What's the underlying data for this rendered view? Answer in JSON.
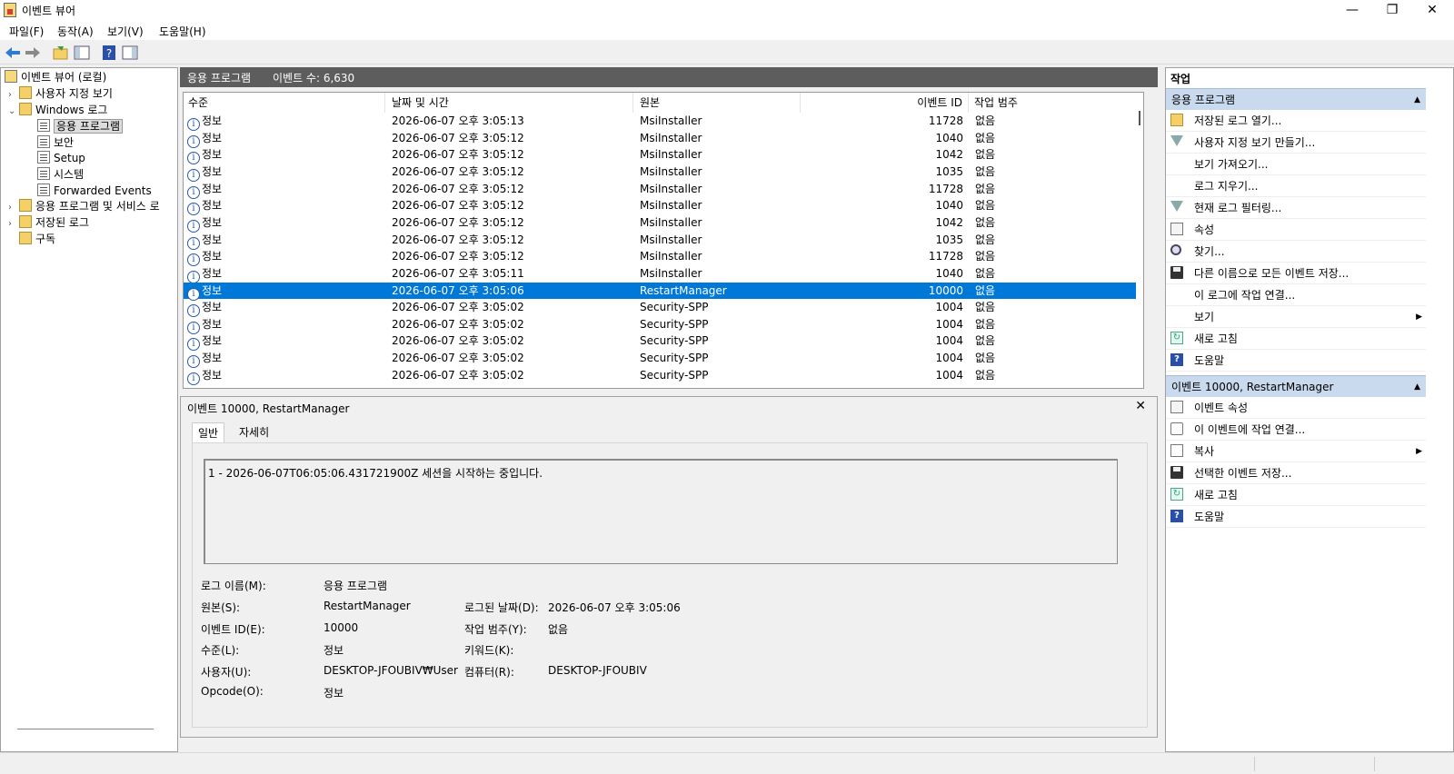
{
  "window": {
    "title": "이벤트 뷰어",
    "controls": {
      "minimize": "—",
      "maximize": "❐",
      "close": "✕"
    }
  },
  "menubar": {
    "items": [
      "파일(F)",
      "동작(A)",
      "보기(V)",
      "도움말(H)"
    ]
  },
  "tree": {
    "root": "이벤트 뷰어 (로컬)",
    "custom_views": "사용자 지정 보기",
    "windows_logs": "Windows 로그",
    "application": "응용 프로그램",
    "security": "보안",
    "setup": "Setup",
    "system": "시스템",
    "forwarded": "Forwarded Events",
    "apps_services": "응용 프로그램 및 서비스 로",
    "saved_logs": "저장된 로그",
    "subscriptions": "구독"
  },
  "list": {
    "header_title": "응용 프로그램",
    "event_count": "이벤트 수: 6,630",
    "columns": {
      "level": "수준",
      "date": "날짜 및 시간",
      "source": "원본",
      "event_id": "이벤트 ID",
      "category": "작업 범주"
    },
    "rows": [
      {
        "level": "정보",
        "date": "2026-06-07 오후 3:05:13",
        "source": "MsiInstaller",
        "event_id": "11728",
        "category": "없음"
      },
      {
        "level": "정보",
        "date": "2026-06-07 오후 3:05:12",
        "source": "MsiInstaller",
        "event_id": "1040",
        "category": "없음"
      },
      {
        "level": "정보",
        "date": "2026-06-07 오후 3:05:12",
        "source": "MsiInstaller",
        "event_id": "1042",
        "category": "없음"
      },
      {
        "level": "정보",
        "date": "2026-06-07 오후 3:05:12",
        "source": "MsiInstaller",
        "event_id": "1035",
        "category": "없음"
      },
      {
        "level": "정보",
        "date": "2026-06-07 오후 3:05:12",
        "source": "MsiInstaller",
        "event_id": "11728",
        "category": "없음"
      },
      {
        "level": "정보",
        "date": "2026-06-07 오후 3:05:12",
        "source": "MsiInstaller",
        "event_id": "1040",
        "category": "없음"
      },
      {
        "level": "정보",
        "date": "2026-06-07 오후 3:05:12",
        "source": "MsiInstaller",
        "event_id": "1042",
        "category": "없음"
      },
      {
        "level": "정보",
        "date": "2026-06-07 오후 3:05:12",
        "source": "MsiInstaller",
        "event_id": "1035",
        "category": "없음"
      },
      {
        "level": "정보",
        "date": "2026-06-07 오후 3:05:12",
        "source": "MsiInstaller",
        "event_id": "11728",
        "category": "없음"
      },
      {
        "level": "정보",
        "date": "2026-06-07 오후 3:05:11",
        "source": "MsiInstaller",
        "event_id": "1040",
        "category": "없음"
      },
      {
        "level": "정보",
        "date": "2026-06-07 오후 3:05:06",
        "source": "RestartManager",
        "event_id": "10000",
        "category": "없음"
      },
      {
        "level": "정보",
        "date": "2026-06-07 오후 3:05:02",
        "source": "Security-SPP",
        "event_id": "1004",
        "category": "없음"
      },
      {
        "level": "정보",
        "date": "2026-06-07 오후 3:05:02",
        "source": "Security-SPP",
        "event_id": "1004",
        "category": "없음"
      },
      {
        "level": "정보",
        "date": "2026-06-07 오후 3:05:02",
        "source": "Security-SPP",
        "event_id": "1004",
        "category": "없음"
      },
      {
        "level": "정보",
        "date": "2026-06-07 오후 3:05:02",
        "source": "Security-SPP",
        "event_id": "1004",
        "category": "없음"
      },
      {
        "level": "정보",
        "date": "2026-06-07 오후 3:05:02",
        "source": "Security-SPP",
        "event_id": "1004",
        "category": "없음"
      }
    ],
    "selected_index": 10
  },
  "detail": {
    "title": "이벤트 10000, RestartManager",
    "close": "✕",
    "tabs": {
      "general": "일반",
      "details": "자세히"
    },
    "message": "1 - 2026-06-07T06:05:06.431721900Z 세션을 시작하는 중입니다.",
    "labels": {
      "log_name": "로그 이름(M):",
      "source": "원본(S):",
      "event_id": "이벤트 ID(E):",
      "level": "수준(L):",
      "user": "사용자(U):",
      "opcode": "Opcode(O):",
      "logged": "로그된 날짜(D):",
      "category": "작업 범주(Y):",
      "keywords": "키워드(K):",
      "computer": "컴퓨터(R):"
    },
    "values": {
      "log_name": "응용 프로그램",
      "source": "RestartManager",
      "event_id": "10000",
      "level": "정보",
      "user": "DESKTOP-JFOUBIV₩User",
      "opcode": "정보",
      "logged": "2026-06-07 오후 3:05:06",
      "category": "없음",
      "keywords": "",
      "computer": "DESKTOP-JFOUBIV"
    }
  },
  "actions": {
    "title": "작업",
    "section1": "응용 프로그램",
    "items1": [
      "저장된 로그 열기...",
      "사용자 지정 보기 만들기...",
      "보기 가져오기...",
      "로그 지우기...",
      "현재 로그 필터링...",
      "속성",
      "찾기...",
      "다른 이름으로 모든 이벤트 저장...",
      "이 로그에 작업 연결...",
      "보기",
      "새로 고침",
      "도움말"
    ],
    "section2": "이벤트 10000, RestartManager",
    "items2": [
      "이벤트 속성",
      "이 이벤트에 작업 연결...",
      "복사",
      "선택한 이벤트 저장...",
      "새로 고침",
      "도움말"
    ]
  },
  "colors": {
    "selection": "#0078d7",
    "header_bg": "#5d5d5d",
    "section_bg": "#c9daee"
  }
}
